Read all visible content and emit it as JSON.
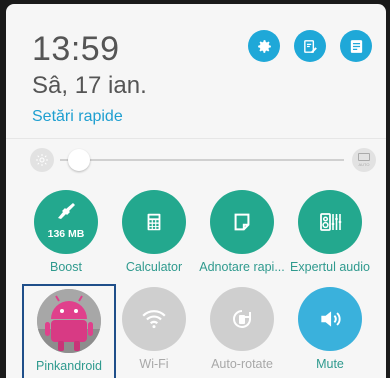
{
  "header": {
    "time": "13:59",
    "date": "Sâ, 17 ian.",
    "quick_settings_title": "Setări rapide",
    "buttons": [
      {
        "name": "settings-gear-icon",
        "color": "#1fa8d8"
      },
      {
        "name": "edit-notes-icon",
        "color": "#1fa8d8"
      },
      {
        "name": "notes-list-icon",
        "color": "#1fa8d8"
      }
    ]
  },
  "brightness": {
    "level": 0.04,
    "auto_label": "AUTO"
  },
  "tiles": [
    {
      "label": "Boost",
      "sublabel": "136 MB",
      "state": "on",
      "icon": "broom-icon",
      "color": "#23a88e"
    },
    {
      "label": "Calculator",
      "state": "on",
      "icon": "calculator-icon",
      "color": "#23a88e"
    },
    {
      "label": "Adnotare rapi...",
      "state": "on",
      "icon": "sticky-note-icon",
      "color": "#23a88e"
    },
    {
      "label": "Expertul audio",
      "state": "on",
      "icon": "audio-expert-icon",
      "color": "#23a88e"
    },
    {
      "label": "Pinkandroid",
      "state": "selected",
      "icon": "pink-android-photo",
      "color": "#e0408c"
    },
    {
      "label": "Wi-Fi",
      "state": "off",
      "icon": "wifi-icon",
      "color": "#cfcfcf"
    },
    {
      "label": "Auto-rotate",
      "state": "off",
      "icon": "auto-rotate-icon",
      "color": "#cfcfcf"
    },
    {
      "label": "Mute",
      "state": "on",
      "icon": "speaker-icon",
      "color": "#3ab1dc"
    }
  ]
}
